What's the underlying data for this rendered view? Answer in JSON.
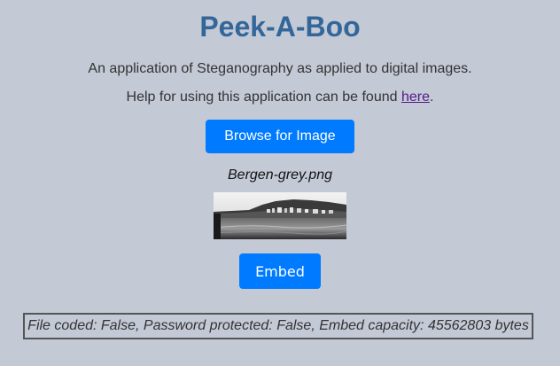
{
  "header": {
    "title": "Peek-A-Boo"
  },
  "intro": {
    "text": "An application of Steganography as applied to digital images."
  },
  "help": {
    "prefix": "Help for using this application can be found ",
    "link_text": "here",
    "suffix": "."
  },
  "browse": {
    "label": "Browse for Image"
  },
  "image": {
    "filename": "Bergen-grey.png"
  },
  "embed": {
    "label": "Embed"
  },
  "status": {
    "text": "File coded: False, Password protected: False, Embed capacity: 45562803 bytes"
  },
  "colors": {
    "background": "#c4c9d6",
    "title": "#336699",
    "button": "#007bff",
    "link": "#551a8b"
  }
}
